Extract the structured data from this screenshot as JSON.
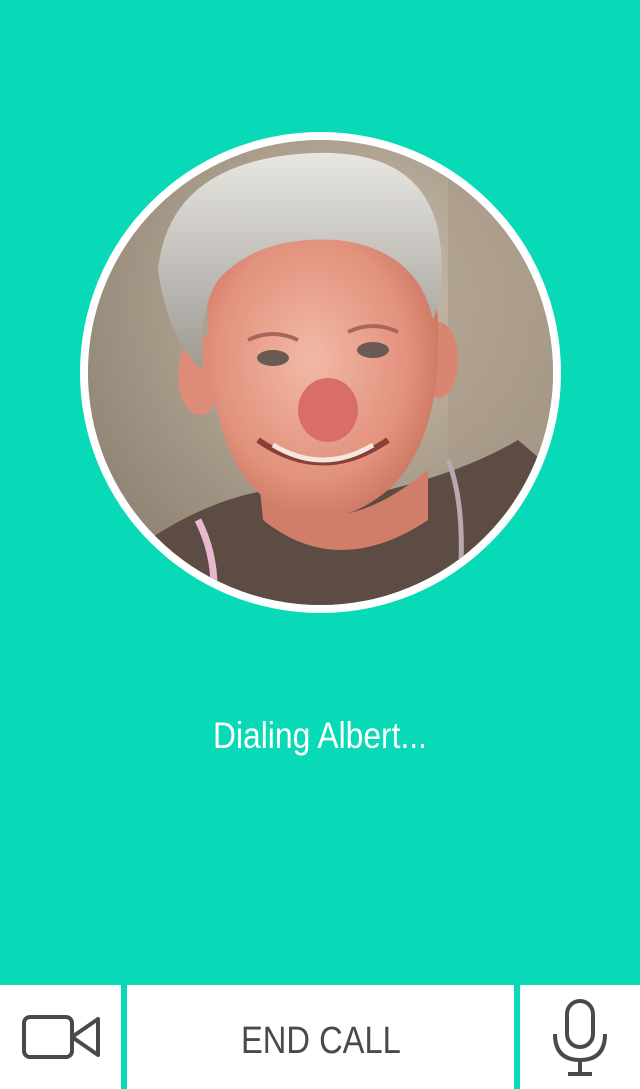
{
  "call": {
    "status_text": "Dialing Albert...",
    "contact_avatar": "contact-photo"
  },
  "actions": {
    "video_icon": "video-camera-icon",
    "end_call_label": "END CALL",
    "mic_icon": "microphone-icon"
  },
  "colors": {
    "background": "#08D9B6",
    "button_bg": "#FFFFFF",
    "button_text": "#4A4A4A",
    "status_text": "#FFFFFF"
  }
}
